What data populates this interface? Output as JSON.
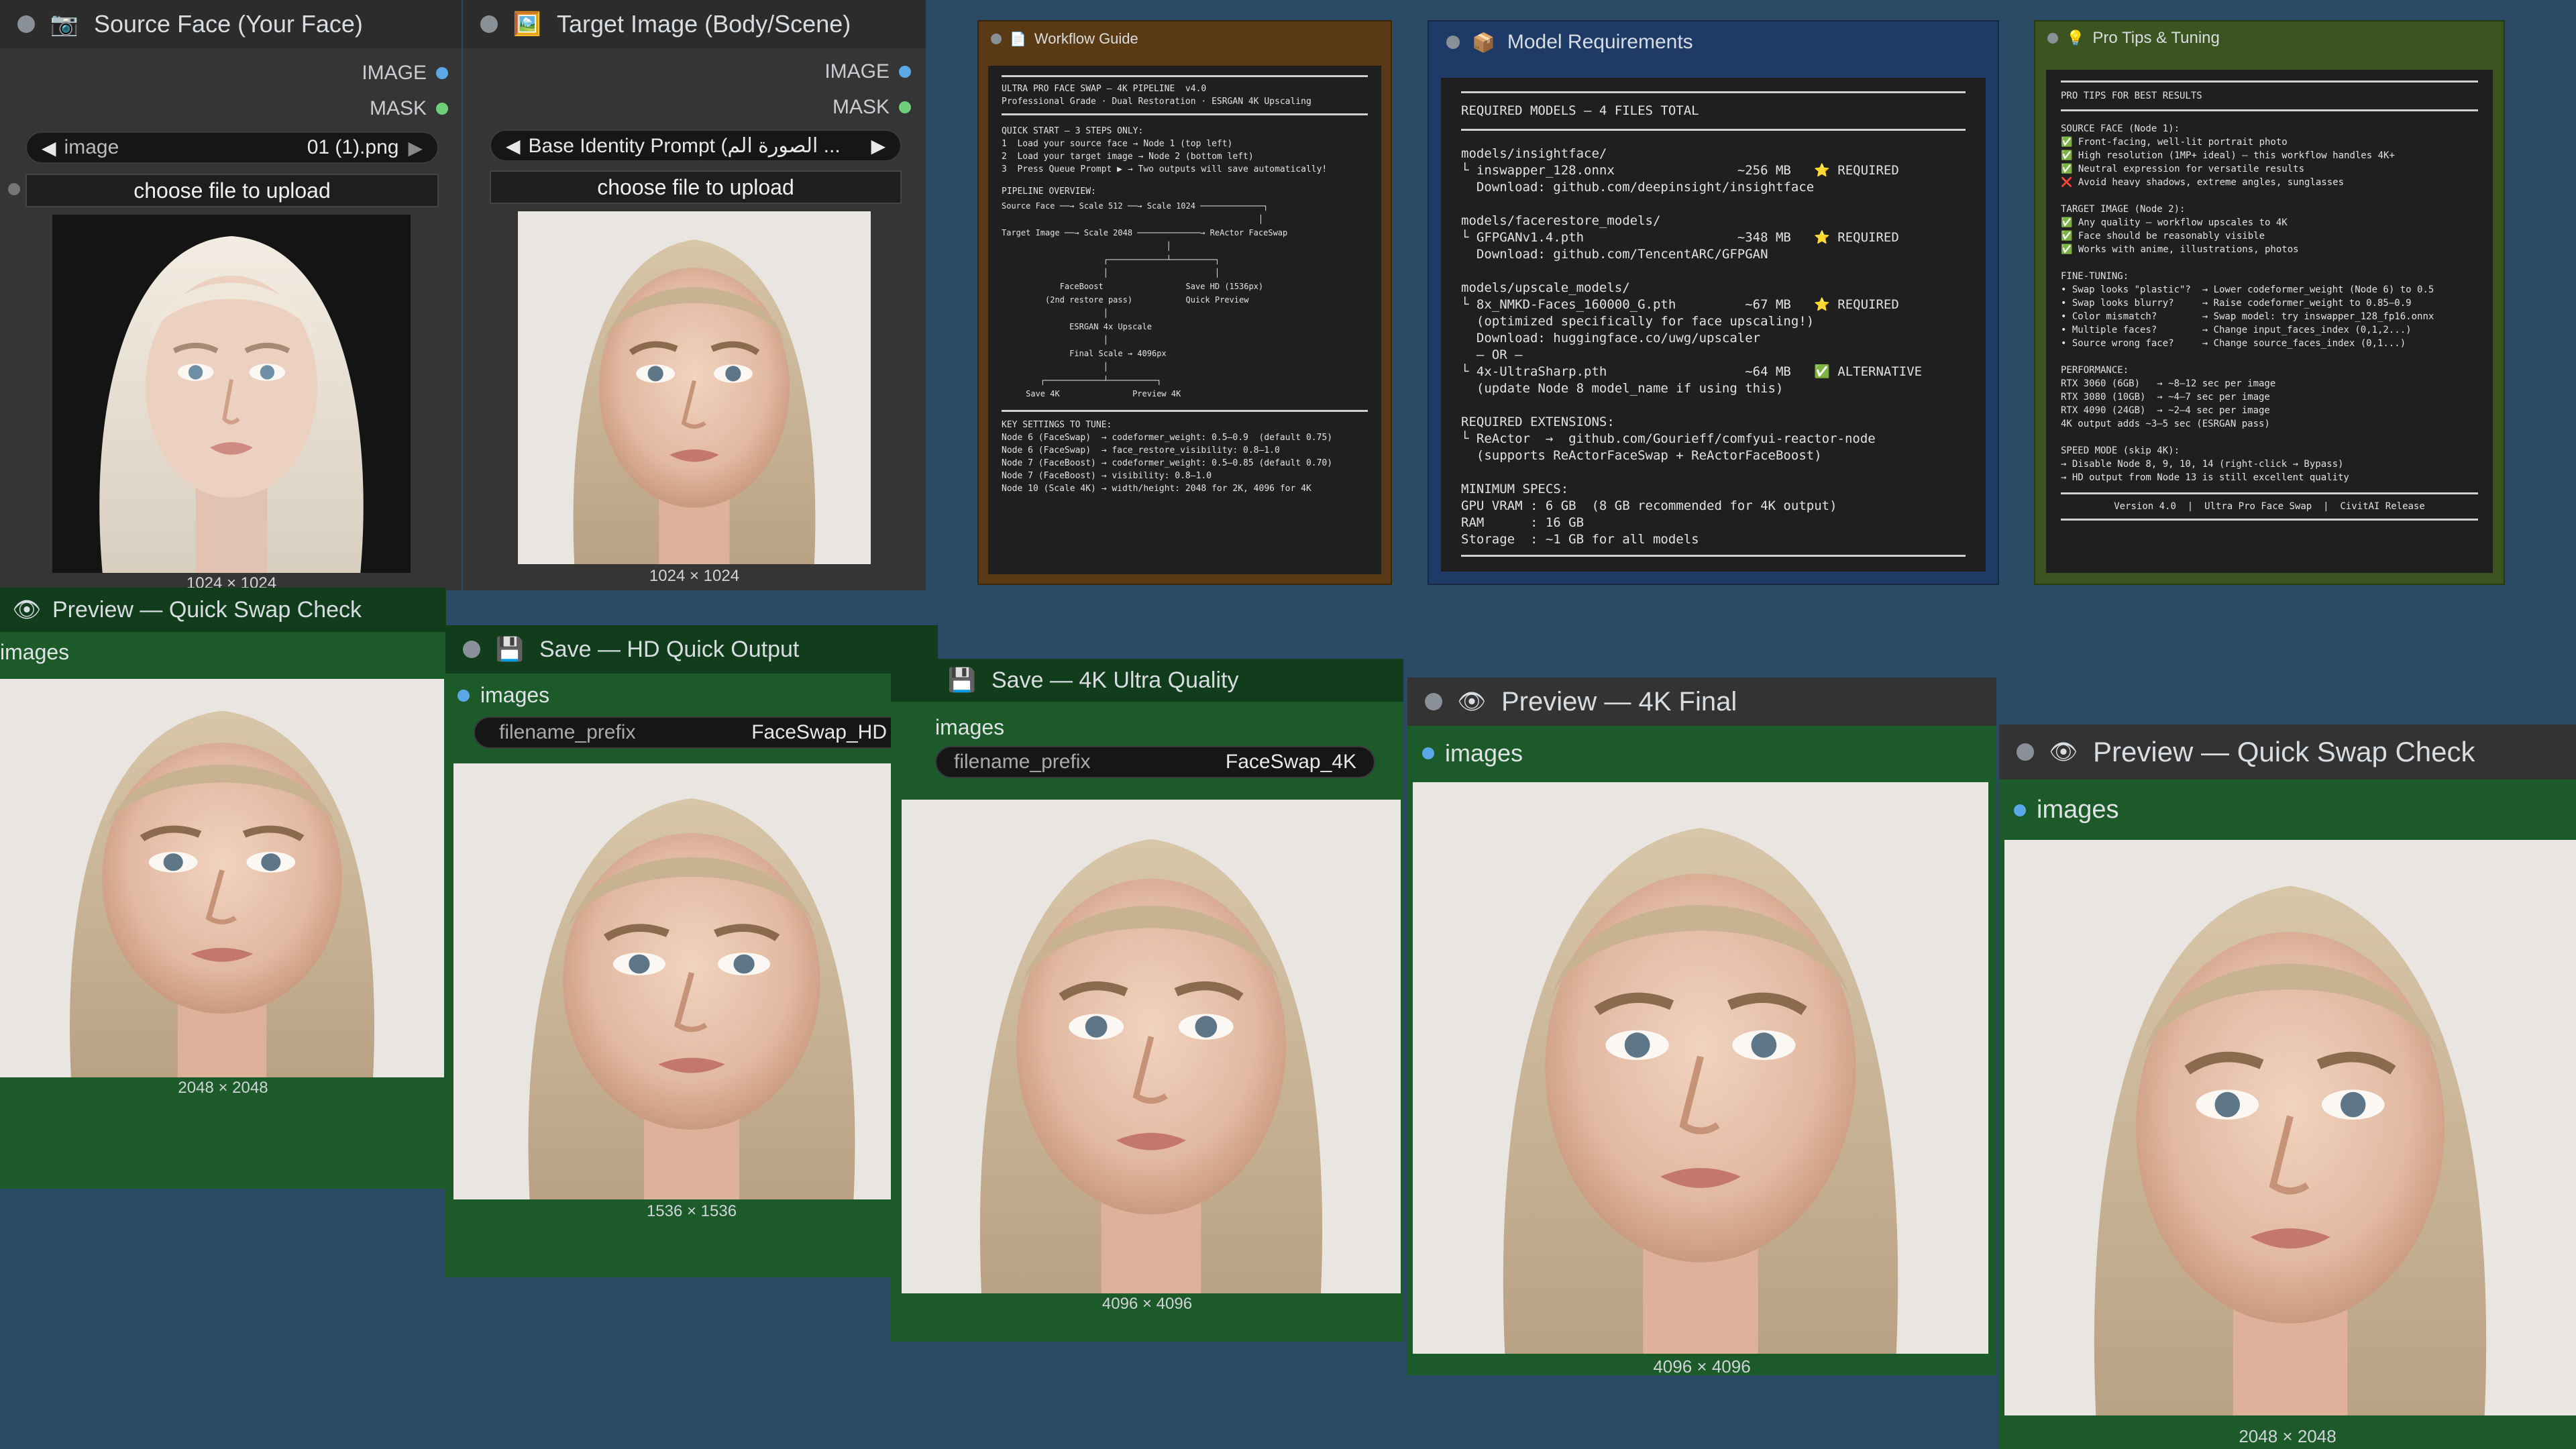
{
  "colors": {
    "canvas": "#2a4a66",
    "node_dark": "#353535",
    "node_green": "#1c5a2a",
    "note_brown": "#5a3a14",
    "note_blue": "#1e3a66",
    "note_olive": "#3b5420",
    "port_image": "#5aa8e8",
    "port_mask": "#6fd07a"
  },
  "source_node": {
    "icon": "camera-icon",
    "title": "Source Face (Your Face)",
    "output_image": "IMAGE",
    "output_mask": "MASK",
    "image_label": "image",
    "image_value": "01 (1).png",
    "upload_label": "choose file to upload",
    "caption": "1024 × 1024"
  },
  "target_node": {
    "icon": "picture-icon",
    "title": "Target Image (Body/Scene)",
    "output_image": "IMAGE",
    "output_mask": "MASK",
    "image_value": "Base Identity Prompt (الصورة الم ...",
    "upload_label": "choose file to upload",
    "caption": "1024 × 1024"
  },
  "preview_left": {
    "icon": "eye-icon",
    "title": "Preview — Quick Swap Check",
    "input_label": "images",
    "caption": "2048 × 2048"
  },
  "save_hd": {
    "icon": "floppy-icon",
    "title": "Save — HD Quick Output",
    "input_label": "images",
    "prefix_label": "filename_prefix",
    "prefix_value": "FaceSwap_HD",
    "caption": "1536 × 1536"
  },
  "save_4k": {
    "icon": "floppy-icon",
    "title": "Save — 4K Ultra Quality",
    "input_label": "images",
    "prefix_label": "filename_prefix",
    "prefix_value": "FaceSwap_4K",
    "caption": "4096 × 4096"
  },
  "preview_4k": {
    "icon": "eye-icon",
    "title": "Preview — 4K Final",
    "input_label": "images",
    "caption": "4096 × 4096"
  },
  "preview_right": {
    "icon": "eye-icon",
    "title": "Preview — Quick Swap Check",
    "input_label": "images",
    "caption": "2048 × 2048"
  },
  "workflow_guide": {
    "icon": "document-icon",
    "title": "Workflow Guide",
    "header": "ULTRA PRO FACE SWAP — 4K PIPELINE  v4.0\nProfessional Grade · Dual Restoration · ESRGAN 4K Upscaling",
    "quick_start": "QUICK START — 3 STEPS ONLY:\n1  Load your source face → Node 1 (top left)\n2  Load your target image → Node 2 (bottom left)\n3  Press Queue Prompt ▶ → Two outputs will save automatically!",
    "pipeline_title": "PIPELINE OVERVIEW:",
    "pipeline": "Source Face ──→ Scale 512 ──→ Scale 1024 ─────────────┐\n                                                     │\nTarget Image ──→ Scale 2048 ─────────────→ ReActor FaceSwap\n                                  │\n                     ┌────────────┴─────────┐\n                     │                      │\n            FaceBoost                 Save HD (1536px)\n         (2nd restore pass)           Quick Preview\n                     │\n              ESRGAN 4x Upscale\n                     │\n              Final Scale → 4096px\n                     │\n        ┌────────────┴──────────┐\n     Save 4K               Preview 4K",
    "key_settings": "KEY SETTINGS TO TUNE:\nNode 6 (FaceSwap)  → codeformer_weight: 0.5–0.9  (default 0.75)\nNode 6 (FaceSwap)  → face_restore_visibility: 0.8–1.0\nNode 7 (FaceBoost) → codeformer_weight: 0.5–0.85 (default 0.70)\nNode 7 (FaceBoost) → visibility: 0.8–1.0\nNode 10 (Scale 4K) → width/height: 2048 for 2K, 4096 for 4K"
  },
  "model_requirements": {
    "icon": "package-icon",
    "title": "Model Requirements",
    "header": "REQUIRED MODELS — 4 FILES TOTAL",
    "body": "models/insightface/\n└ inswapper_128.onnx                ~256 MB   ⭐ REQUIRED\n  Download: github.com/deepinsight/insightface\n\nmodels/facerestore_models/\n└ GFPGANv1.4.pth                    ~348 MB   ⭐ REQUIRED\n  Download: github.com/TencentARC/GFPGAN\n\nmodels/upscale_models/\n└ 8x_NMKD-Faces_160000_G.pth         ~67 MB   ⭐ REQUIRED\n  (optimized specifically for face upscaling!)\n  Download: huggingface.co/uwg/upscaler\n  — OR —\n└ 4x-UltraSharp.pth                  ~64 MB   ✅ ALTERNATIVE\n  (update Node 8 model_name if using this)\n\nREQUIRED EXTENSIONS:\n└ ReActor  →  github.com/Gourieff/comfyui-reactor-node\n  (supports ReActorFaceSwap + ReActorFaceBoost)\n\nMINIMUM SPECS:\nGPU VRAM : 6 GB  (8 GB recommended for 4K output)\nRAM      : 16 GB\nStorage  : ~1 GB for all models"
  },
  "pro_tips": {
    "icon": "lightbulb-icon",
    "title": "Pro Tips & Tuning",
    "header": "PRO TIPS FOR BEST RESULTS",
    "body": "SOURCE FACE (Node 1):\n✅ Front-facing, well-lit portrait photo\n✅ High resolution (1MP+ ideal) — this workflow handles 4K+\n✅ Neutral expression for versatile results\n❌ Avoid heavy shadows, extreme angles, sunglasses\n\nTARGET IMAGE (Node 2):\n✅ Any quality — workflow upscales to 4K\n✅ Face should be reasonably visible\n✅ Works with anime, illustrations, photos\n\nFINE-TUNING:\n• Swap looks \"plastic\"?  → Lower codeformer_weight (Node 6) to 0.5\n• Swap looks blurry?     → Raise codeformer_weight to 0.85–0.9\n• Color mismatch?        → Swap model: try inswapper_128_fp16.onnx\n• Multiple faces?        → Change input_faces_index (0,1,2...)\n• Source wrong face?     → Change source_faces_index (0,1...)\n\nPERFORMANCE:\nRTX 3060 (6GB)   → ~8–12 sec per image\nRTX 3080 (10GB)  → ~4–7 sec per image\nRTX 4090 (24GB)  → ~2–4 sec per image\n4K output adds ~3–5 sec (ESRGAN pass)\n\nSPEED MODE (skip 4K):\n→ Disable Node 8, 9, 10, 14 (right-click → Bypass)\n→ HD output from Node 13 is still excellent quality",
    "footer": "Version 4.0  |  Ultra Pro Face Swap  |  CivitAI Release"
  }
}
